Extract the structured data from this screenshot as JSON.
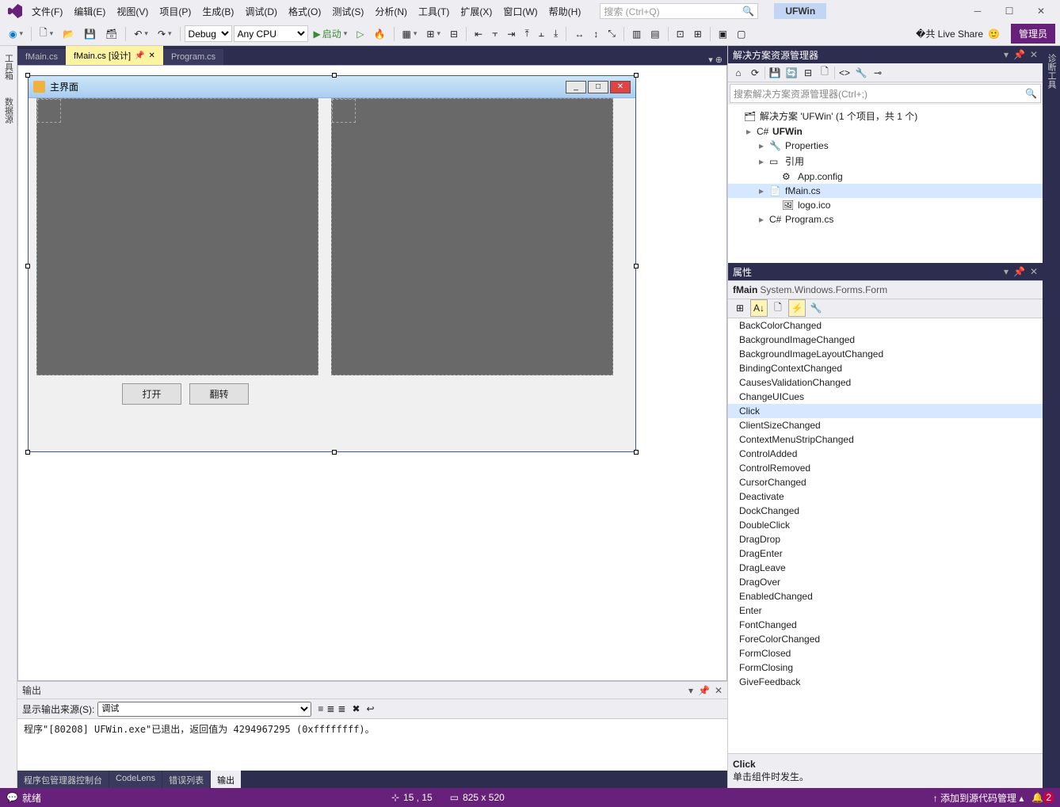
{
  "titlebar": {
    "appname": "UFWin",
    "search_placeholder": "搜索 (Ctrl+Q)"
  },
  "menus": [
    "文件(F)",
    "编辑(E)",
    "视图(V)",
    "项目(P)",
    "生成(B)",
    "调试(D)",
    "格式(O)",
    "测试(S)",
    "分析(N)",
    "工具(T)",
    "扩展(X)",
    "窗口(W)",
    "帮助(H)"
  ],
  "toolbar": {
    "config": "Debug",
    "platform": "Any CPU",
    "start": "启动",
    "liveshare": "Live Share",
    "admin": "管理员"
  },
  "leftrail": [
    "工具箱",
    "数据源"
  ],
  "rightrail": [
    "诊断工具"
  ],
  "tabs": [
    {
      "label": "fMain.cs",
      "active": false
    },
    {
      "label": "fMain.cs [设计]",
      "active": true
    },
    {
      "label": "Program.cs",
      "active": false
    }
  ],
  "form": {
    "title": "主界面",
    "btn1": "打开",
    "btn2": "翻转"
  },
  "output": {
    "title": "输出",
    "source_label": "显示输出来源(S):",
    "source": "调试",
    "text": "程序\"[80208] UFWin.exe\"已退出，返回值为 4294967295 (0xffffffff)。"
  },
  "bottabs": [
    "程序包管理器控制台",
    "CodeLens",
    "错误列表",
    "输出"
  ],
  "solution": {
    "title": "解决方案资源管理器",
    "search_placeholder": "搜索解决方案资源管理器(Ctrl+;)",
    "root": "解决方案 'UFWin' (1 个项目，共 1 个)",
    "project": "UFWin",
    "nodes": [
      "Properties",
      "引用",
      "App.config",
      "fMain.cs",
      "logo.ico",
      "Program.cs"
    ]
  },
  "props": {
    "title": "属性",
    "object": "fMain",
    "objtype": "System.Windows.Forms.Form",
    "items": [
      "BackColorChanged",
      "BackgroundImageChanged",
      "BackgroundImageLayoutChanged",
      "BindingContextChanged",
      "CausesValidationChanged",
      "ChangeUICues",
      "Click",
      "ClientSizeChanged",
      "ContextMenuStripChanged",
      "ControlAdded",
      "ControlRemoved",
      "CursorChanged",
      "Deactivate",
      "DockChanged",
      "DoubleClick",
      "DragDrop",
      "DragEnter",
      "DragLeave",
      "DragOver",
      "EnabledChanged",
      "Enter",
      "FontChanged",
      "ForeColorChanged",
      "FormClosed",
      "FormClosing",
      "GiveFeedback"
    ],
    "selected": "Click",
    "desc_title": "Click",
    "desc_text": "单击组件时发生。"
  },
  "status": {
    "ready": "就绪",
    "pos": "15 , 15",
    "size": "825 x 520",
    "srcctrl": "添加到源代码管理",
    "notif": "2"
  }
}
